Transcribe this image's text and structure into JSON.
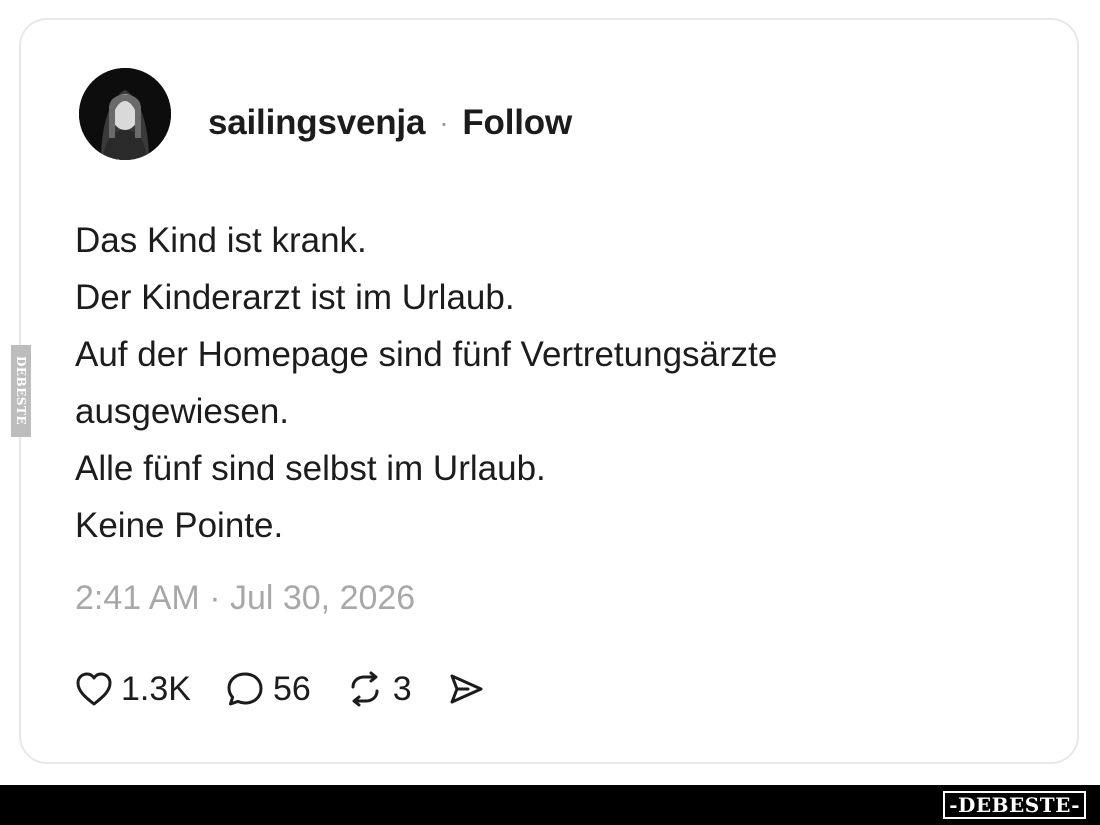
{
  "post": {
    "username": "sailingsvenja",
    "separator": "·",
    "follow_label": "Follow",
    "text_lines": [
      "Das Kind ist krank.",
      "Der Kinderarzt ist im Urlaub.",
      "Auf der Homepage sind fünf Vertretungsärzte",
      "ausgewiesen.",
      "Alle fünf sind selbst im Urlaub.",
      "Keine Pointe."
    ],
    "timestamp": "2:41 AM · Jul 30, 2026"
  },
  "actions": {
    "like": {
      "icon": "heart-icon",
      "count": "1.3K"
    },
    "comment": {
      "icon": "speech-bubble-icon",
      "count": "56"
    },
    "repost": {
      "icon": "repost-icon",
      "count": "3"
    },
    "share": {
      "icon": "send-icon"
    }
  },
  "watermark": {
    "brand": "-DEBESTE-",
    "side_mark": "DEBESTE"
  }
}
